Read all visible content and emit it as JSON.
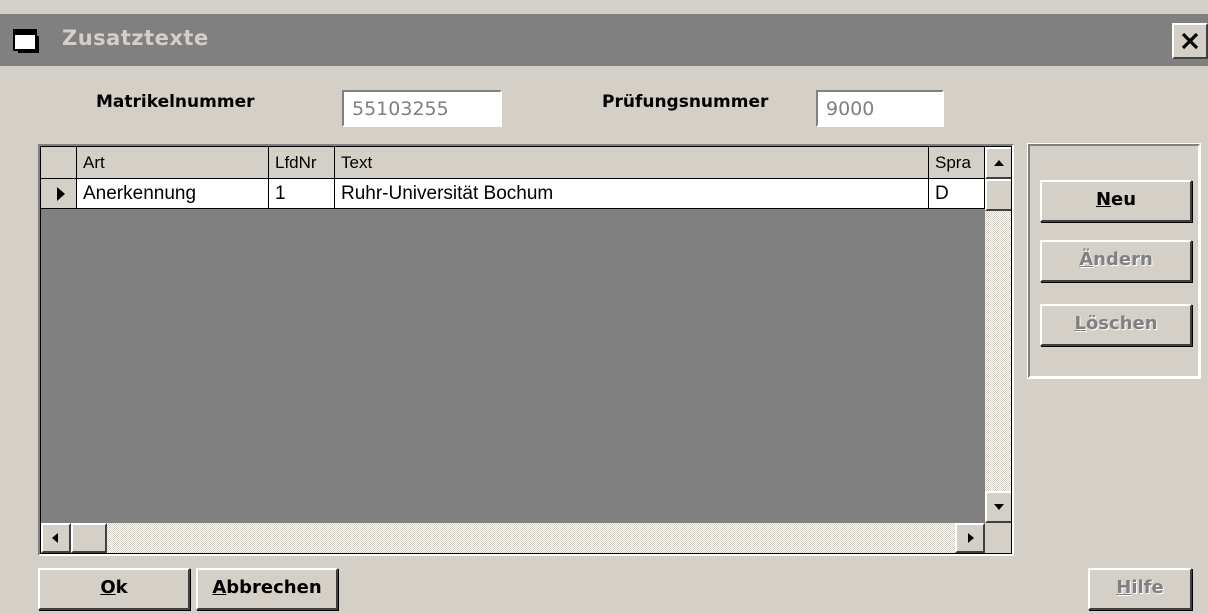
{
  "window": {
    "title": "Zusatztexte",
    "icons": {
      "app": "window-icon",
      "close": "close-icon"
    }
  },
  "form": {
    "matrikel_label": "Matrikelnummer",
    "matrikel_value": "55103255",
    "pruefung_label": "Prüfungsnummer",
    "pruefung_value": "9000"
  },
  "grid": {
    "columns": [
      "Art",
      "LfdNr",
      "Text",
      "Sprache"
    ],
    "column_headers_visible": [
      "Art",
      "LfdNr",
      "Text",
      "Spra"
    ],
    "rows": [
      {
        "art": "Anerkennung",
        "lfdnr": "1",
        "text": "Ruhr-Universität Bochum",
        "sprache": "D",
        "selected": true
      }
    ],
    "icons": {
      "row_pointer": "row-pointer-icon",
      "scroll_up": "arrow-up-icon",
      "scroll_down": "arrow-down-icon",
      "scroll_left": "arrow-left-icon",
      "scroll_right": "arrow-right-icon"
    }
  },
  "side_buttons": {
    "neu": {
      "label_accel": "N",
      "label_rest": "eu",
      "enabled": true
    },
    "aendern": {
      "label_accel": "Ä",
      "label_rest": "ndern",
      "enabled": false
    },
    "loeschen": {
      "label_accel": "L",
      "label_rest": "öschen",
      "enabled": false
    }
  },
  "bottom_buttons": {
    "ok": {
      "label_accel": "O",
      "label_rest": "k",
      "enabled": true
    },
    "abbrechen": {
      "label_accel": "A",
      "label_rest": "bbrechen",
      "enabled": true
    },
    "hilfe": {
      "label_accel": "H",
      "label_rest": "ilfe",
      "enabled": false
    }
  },
  "colors": {
    "face": "#d4d0c8",
    "titlebar_inactive": "#808080",
    "grid_background": "#808080",
    "disabled_text": "#808080"
  }
}
